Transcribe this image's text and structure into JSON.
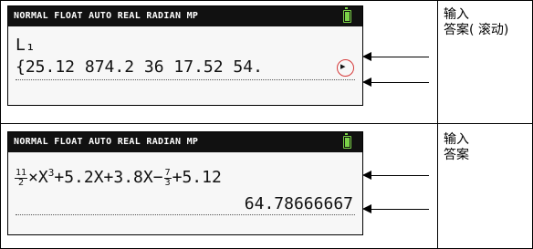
{
  "top": {
    "status_bar": "NORMAL FLOAT AUTO REAL RADIAN MP",
    "list_name": "L₁",
    "list_values": "{25.12 874.2 36 17.52 54.",
    "label_line1": "输入",
    "label_line2": "答案( 滚动)"
  },
  "bottom": {
    "status_bar": "NORMAL FLOAT AUTO REAL RADIAN MP",
    "frac1_num": "11",
    "frac1_den": "2",
    "expr_part1": "×X",
    "exp3": "3",
    "expr_part2": "+5.2X+3.8X−",
    "frac2_num": "7",
    "frac2_den": "3",
    "expr_part3": "+5.12",
    "result": "64.78666667",
    "label_line1": "输入",
    "label_line2": "答案"
  },
  "icons": {
    "battery": "battery-icon",
    "scroll": "scroll-right-icon"
  }
}
